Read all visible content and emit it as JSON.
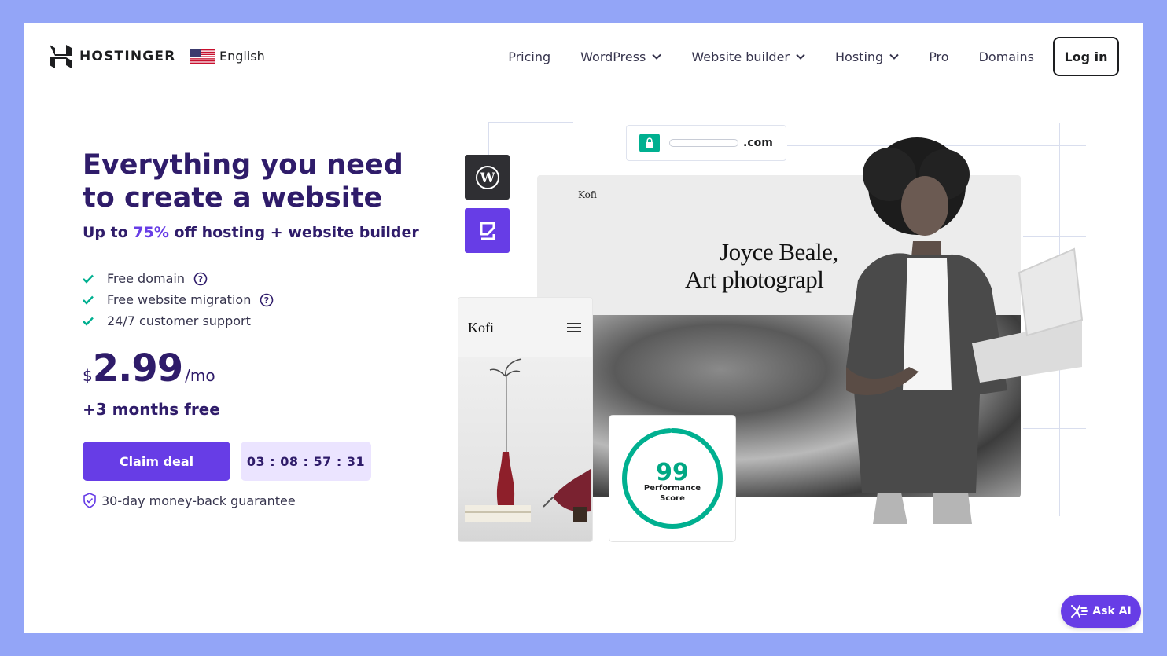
{
  "header": {
    "brand": "HOSTINGER",
    "language": "English",
    "nav": [
      {
        "label": "Pricing",
        "has_dropdown": false
      },
      {
        "label": "WordPress",
        "has_dropdown": true
      },
      {
        "label": "Website builder",
        "has_dropdown": true
      },
      {
        "label": "Hosting",
        "has_dropdown": true
      },
      {
        "label": "Pro",
        "has_dropdown": false
      },
      {
        "label": "Domains",
        "has_dropdown": false
      }
    ],
    "login_label": "Log in"
  },
  "hero": {
    "title": "Everything you need to create a website",
    "subtitle_prefix": "Up to ",
    "subtitle_accent": "75%",
    "subtitle_suffix": " off hosting + website builder",
    "features": [
      {
        "label": "Free domain",
        "has_help": true
      },
      {
        "label": "Free website migration",
        "has_help": true
      },
      {
        "label": "24/7 customer support",
        "has_help": false
      }
    ],
    "price": {
      "currency": "$",
      "amount": "2.99",
      "period": "/mo"
    },
    "bonus": "+3 months free",
    "cta_label": "Claim deal",
    "timer": "03 : 08 : 57 : 31",
    "guarantee": "30-day money-back guarantee"
  },
  "illustration": {
    "domain_ext": ".com",
    "site_brand": "Kofi",
    "site_headline_1": "Joyce Beale,",
    "site_headline_2": "Art photograpl",
    "mobile_brand": "Kofi",
    "score_value": "99",
    "score_label_1": "Performance",
    "score_label_2": "Score"
  },
  "ask_ai_label": "Ask AI",
  "colors": {
    "page_bg": "#93a5f7",
    "primary": "#673de6",
    "heading": "#2f1c6a",
    "success": "#00b090",
    "timer_bg": "#ebe4ff"
  }
}
